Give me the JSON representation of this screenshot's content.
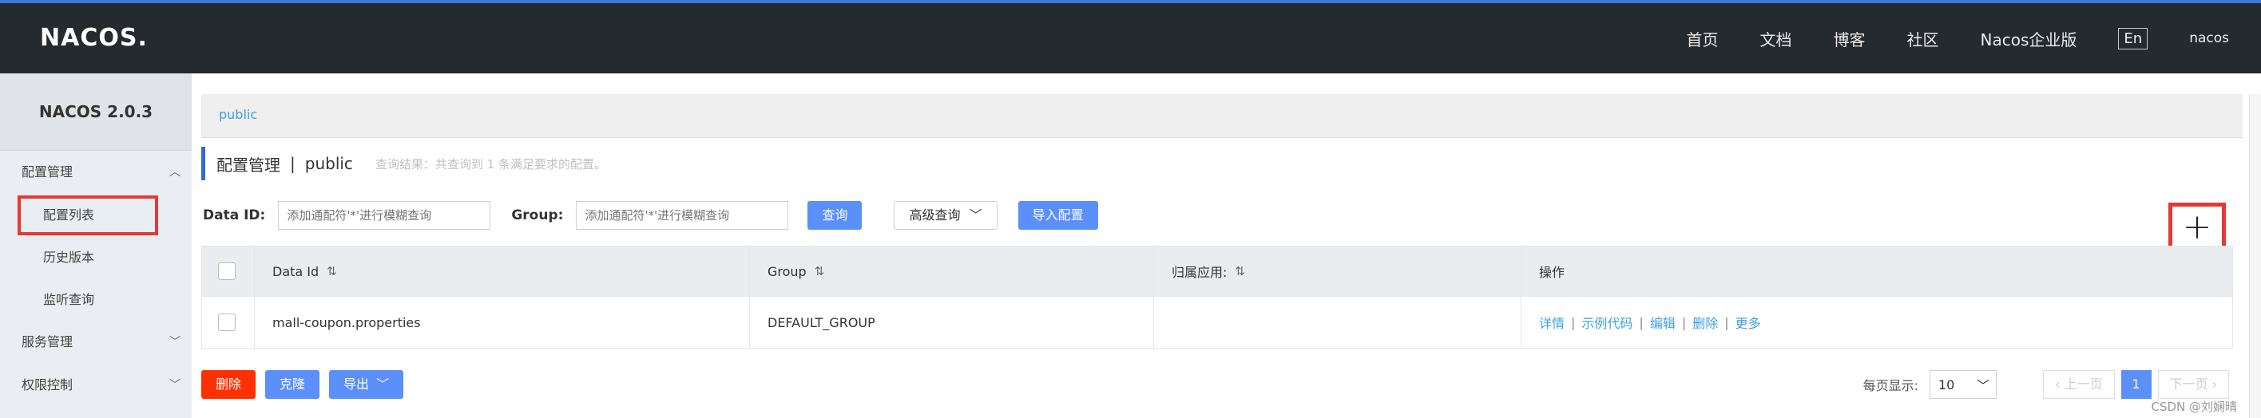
{
  "header": {
    "logo": "NACOS.",
    "nav": [
      "首页",
      "文档",
      "博客",
      "社区",
      "Nacos企业版"
    ],
    "lang": "En",
    "user": "nacos"
  },
  "sidebar": {
    "version": "NACOS 2.0.3",
    "groups": [
      {
        "label": "配置管理",
        "expanded": true,
        "items": [
          "配置列表",
          "历史版本",
          "监听查询"
        ]
      },
      {
        "label": "服务管理",
        "expanded": false
      },
      {
        "label": "权限控制",
        "expanded": false
      }
    ]
  },
  "breadcrumb": "public",
  "page": {
    "title": "配置管理",
    "separator": "|",
    "namespace": "public",
    "result_text": "查询结果：共查询到 1 条满足要求的配置。"
  },
  "filters": {
    "data_id_label": "Data ID:",
    "data_id_placeholder": "添加通配符'*'进行模糊查询",
    "group_label": "Group:",
    "group_placeholder": "添加通配符'*'进行模糊查询",
    "query": "查询",
    "advanced": "高级查询",
    "import": "导入配置"
  },
  "table": {
    "headers": [
      "Data Id",
      "Group",
      "归属应用:",
      "操作"
    ],
    "rows": [
      {
        "data_id": "mall-coupon.properties",
        "group": "DEFAULT_GROUP",
        "app": "",
        "ops": [
          "详情",
          "示例代码",
          "编辑",
          "删除",
          "更多"
        ]
      }
    ]
  },
  "actions": {
    "delete": "删除",
    "clone": "克隆",
    "export": "导出"
  },
  "pagination": {
    "per_page_label": "每页显示:",
    "per_page": "10",
    "prev": "上一页",
    "current": "1",
    "next": "下一页"
  },
  "watermark": "CSDN @刘娴晴",
  "colors": {
    "header_bg": "#252a2f",
    "primary": "#5b8ff9",
    "danger": "#ff3000",
    "highlight": "#e53935"
  }
}
